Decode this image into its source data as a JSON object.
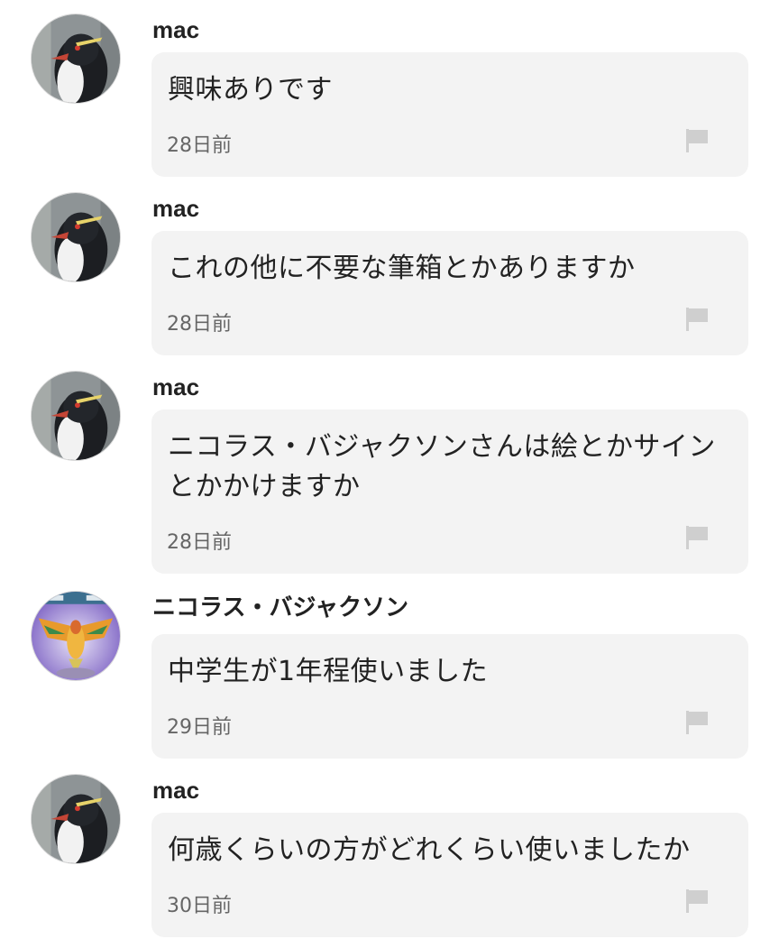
{
  "comments": [
    {
      "user": "mac",
      "avatar": "penguin-avatar",
      "text": "興味ありです",
      "time": "28日前"
    },
    {
      "user": "mac",
      "avatar": "penguin-avatar",
      "text": "これの他に不要な筆箱とかありますか",
      "time": "28日前"
    },
    {
      "user": "mac",
      "avatar": "penguin-avatar",
      "text": "ニコラス・バジャクソンさんは絵とかサインとかかけますか",
      "time": "28日前"
    },
    {
      "user": "ニコラス・バジャクソン",
      "avatar": "bird-game-avatar",
      "text": "中学生が1年程使いました",
      "time": "29日前"
    },
    {
      "user": "mac",
      "avatar": "penguin-avatar",
      "text": "何歳くらいの方がどれくらい使いましたか",
      "time": "30日前"
    }
  ],
  "icons": {
    "report": "flag-icon"
  },
  "colors": {
    "bubble_bg": "#f3f3f3",
    "text": "#222222",
    "meta_text": "#666666",
    "flag": "#cfcfcf"
  }
}
